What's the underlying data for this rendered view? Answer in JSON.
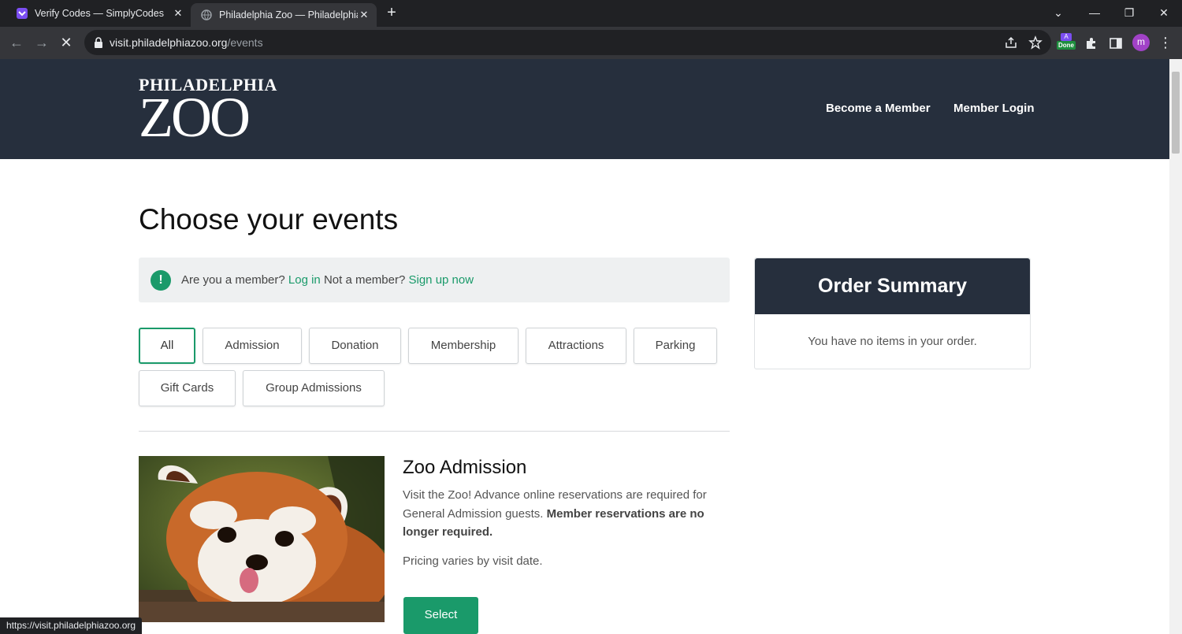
{
  "browser": {
    "tabs": [
      {
        "title": "Verify Codes — SimplyCodes",
        "active": false
      },
      {
        "title": "Philadelphia Zoo — Philadelphia",
        "active": true
      }
    ],
    "url_host": "visit.philadelphiazoo.org",
    "url_path": "/events",
    "extension_badge_top": "A",
    "extension_badge_bottom": "Done",
    "profile_initial": "m",
    "status_url": "https://visit.philadelphiazoo.org"
  },
  "header": {
    "logo_line1": "PHILADELPHIA",
    "logo_line2": "ZOO",
    "nav": [
      "Become a Member",
      "Member Login"
    ]
  },
  "main": {
    "title": "Choose your events",
    "notice": {
      "text1": "Are you a member?",
      "link1": "Log in",
      "text2": "Not a member?",
      "link2": "Sign up now"
    },
    "filters": [
      "All",
      "Admission",
      "Donation",
      "Membership",
      "Attractions",
      "Parking",
      "Gift Cards",
      "Group Admissions"
    ],
    "active_filter": "All",
    "event": {
      "title": "Zoo Admission",
      "desc": "Visit the Zoo! Advance online reservations are required for General Admission guests.",
      "desc_bold": "Member reservations are no longer required.",
      "pricing": "Pricing varies by visit date.",
      "button": "Select",
      "image_alt": "red-panda-photo"
    }
  },
  "summary": {
    "title": "Order Summary",
    "empty": "You have no items in your order."
  },
  "colors": {
    "brand_dark": "#262f3d",
    "accent_green": "#1a9a6a"
  }
}
